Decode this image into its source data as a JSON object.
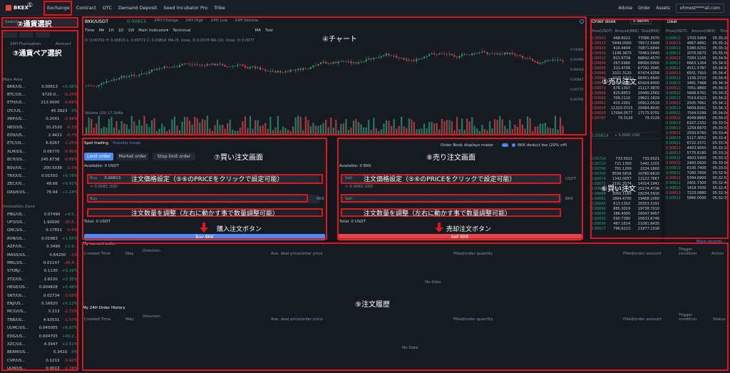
{
  "nav": {
    "logo": "BKEX",
    "items": [
      "Exchange",
      "Contract",
      "OTC",
      "Demand Deposit",
      "Seed Incubator Pro",
      "Tribe"
    ],
    "right": [
      "Advise",
      "Order",
      "Assets"
    ],
    "email": "ohmest****ail.com"
  },
  "market": {
    "search_placeholder": "Search",
    "columns": [
      "24H Fluctuation",
      "Amount"
    ],
    "main_area": "Main Area",
    "innovation_zone": "Innovation Zone",
    "pairs": [
      {
        "name": "BKK/US...",
        "price": "0.00813",
        "change": "+0.36%"
      },
      {
        "name": "BTC/US...",
        "price": "9720.0...",
        "change": "-0.23%"
      },
      {
        "name": "ETH/US...",
        "price": "213.0000",
        "change": "-0.86%"
      },
      {
        "name": "LTC/US...",
        "price": "45.3923",
        "change": "0%"
      },
      {
        "name": "XRP/US...",
        "price": "0.2041",
        "change": "-0.39%"
      },
      {
        "name": "NEO/US...",
        "price": "10.2520",
        "change": "-0.1%"
      },
      {
        "name": "EOS/US...",
        "price": "2.4421",
        "change": "-0.7%"
      },
      {
        "name": "ETC/US...",
        "price": "6.6267",
        "change": "-1.25%"
      },
      {
        "name": "XLM/US...",
        "price": "0.06770",
        "change": "-0.45%"
      },
      {
        "name": "BCH/US...",
        "price": "245.8738",
        "change": "-0.89%"
      },
      {
        "name": "BSV/US...",
        "price": "200.5038",
        "change": "-1.5%"
      },
      {
        "name": "TRX/US...",
        "price": "0.01550",
        "change": "+0.78%"
      },
      {
        "name": "ZEC/US...",
        "price": "48.66",
        "change": "+0.91%"
      },
      {
        "name": "DASH/US...",
        "price": "76.94",
        "change": "+1.24%"
      }
    ],
    "pairs2": [
      {
        "name": "PBG/US...",
        "price": "0.07490",
        "change": "+6.5..."
      },
      {
        "name": "UFO/US...",
        "price": "1.90000",
        "change": "-26.5..."
      },
      {
        "name": "QRC/US...",
        "price": "0.17651",
        "change": "-0.6%"
      },
      {
        "name": "RVN/US...",
        "price": "0.01983",
        "change": "+1.55%"
      },
      {
        "name": "AZP/US...",
        "price": "0.3490",
        "change": "+2.9..."
      },
      {
        "name": "MASS/US...",
        "price": "0.64200",
        "change": "-1%"
      },
      {
        "name": "MRL/US...",
        "price": "0.01147",
        "change": "-16.4..."
      },
      {
        "name": "STORJ/...",
        "price": "0.1130",
        "change": "+3.29%"
      },
      {
        "name": "XTZ/US...",
        "price": "2.8220",
        "change": "+2.35%"
      },
      {
        "name": "HEGE/US...",
        "price": "0.004828",
        "change": "+0.48%"
      },
      {
        "name": "SNT/US...",
        "price": "0.02734",
        "change": "-3.55%"
      },
      {
        "name": "ENJ/US...",
        "price": "0.16620",
        "change": "+5.12%"
      },
      {
        "name": "MCO/US...",
        "price": "5.513",
        "change": "-1.71%"
      },
      {
        "name": "TRB/US...",
        "price": "4.93531",
        "change": "-1.57%"
      },
      {
        "name": "ULMC/US...",
        "price": "0.045005",
        "change": "+6.87%"
      },
      {
        "name": "EDG/US...",
        "price": "0.004705",
        "change": "+40.2..."
      },
      {
        "name": "XZC/US...",
        "price": "4.3947",
        "change": "+2.51%"
      },
      {
        "name": "BEAM/US...",
        "price": "0.3410",
        "change": "0%"
      },
      {
        "name": "CVP/US...",
        "price": "0.1213",
        "change": "-3.42%"
      },
      {
        "name": "ULM/US...",
        "price": "0.0013",
        "change": "-1.18%"
      }
    ]
  },
  "chart": {
    "pair": "BKK/USDT",
    "price": "0.00813",
    "stats": [
      "24H Change",
      "24H High",
      "24H Low",
      "24H Volume"
    ],
    "intervals": [
      "Time",
      "M▾",
      "1H",
      "1D",
      "1W",
      "Main Indicator▾",
      "Technical",
      "MA",
      "Tool"
    ],
    "ohlc": "O: 0.00791  H: 0.00823  L: 0.00772  C: 0.00814",
    "ma": "MA (5, close, 0)  0.0078   MA (10, close, 0)  0.0077",
    "volume_label": "Volume (20)  17.1kMa",
    "y_ticks": [
      "0.01060",
      "0.00989",
      "0.00918",
      "0.00847",
      "0.00775",
      "0.00705"
    ],
    "accent": "#4a8cf7"
  },
  "trade": {
    "tabs": [
      "Spot trading",
      "Transfer funds"
    ],
    "order_types": [
      "Limit order",
      "Market order",
      "Stop-limit order"
    ],
    "available_buy": "Available: 0 USDT",
    "available_sell": "Available: 0 BKK",
    "buy_label": "Buy",
    "sell_label": "Sell",
    "price_value": "0.00813",
    "price_usd": "≈ 0.0081 USD",
    "quote": "USDT",
    "base": "BKK",
    "total": "Total:   0 USDT",
    "buy_button": "Buy BKK",
    "sell_button": "Sell BKK",
    "maker_toggle": "Order Book displays maker",
    "deduct": "BKK  deduct fee  (20% off)"
  },
  "orderbook": {
    "title": "Order Book",
    "depth": "5 decim",
    "columns": [
      "Price(USDT)",
      "Amount(BKK)",
      "Total(BKK)"
    ],
    "asks": [
      [
        "0.00930",
        "468.8022",
        "77086.3070"
      ],
      [
        "0.00923",
        "5444.0000",
        "76572.5048"
      ],
      [
        "0.00920",
        "414.4404",
        "70871.6844"
      ],
      [
        "0.00910",
        "1196.3670",
        "70463.0440"
      ],
      [
        "0.00910",
        "813.9734",
        "68842.4570"
      ],
      [
        "0.00899",
        "267.6966",
        "68060.0000"
      ],
      [
        "0.00895",
        "313.4706",
        "67792.3045"
      ],
      [
        "0.00890",
        "1021.3120",
        "67474.9258"
      ],
      [
        "0.00880",
        "1025.3210",
        "66451.6640"
      ],
      [
        "0.00875",
        "400.0000",
        "65424.8900"
      ],
      [
        "0.00872",
        "676.1307",
        "21117.3870"
      ],
      [
        "0.00869",
        "820.8653",
        "20440.3563"
      ],
      [
        "0.00865",
        "709.1110",
        "19621.1629"
      ],
      [
        "0.00862",
        "415.2001",
        "20912.0519"
      ],
      [
        "0.00826",
        "11320.0723",
        "20494.8630"
      ],
      [
        "0.00825",
        "17094.0577",
        "17175.9701"
      ],
      [
        "0.00797",
        "79.3129",
        "79.3129"
      ]
    ],
    "last_price": "0.00814",
    "last_usd": "≈ 0.0081 USD",
    "bids": [
      [
        "0.00724",
        "733.0021",
        "733.0021"
      ],
      [
        "0.00710",
        "721.1300",
        "1442.2201"
      ],
      [
        "0.00706",
        "761.1299",
        "2224.1600"
      ],
      [
        "0.00700",
        "8556.5818",
        "10780.6610"
      ],
      [
        "0.00674",
        "1342.0057",
        "12122.7667"
      ],
      [
        "0.00672",
        "2191.3574",
        "14314.1041"
      ],
      [
        "0.00670",
        "3142.3435",
        "15174.4736"
      ],
      [
        "0.00668",
        "3060.1180",
        "18234.5916"
      ],
      [
        "0.00662",
        "1864.4700",
        "19468.1000"
      ],
      [
        "0.00660",
        "613.1302",
        "20353.3191"
      ],
      [
        "0.00656",
        "885.3019",
        "19738.7010"
      ],
      [
        "0.00645",
        "386.4000",
        "20047.9457"
      ],
      [
        "0.00630",
        "590.7390",
        "20633.6746"
      ],
      [
        "0.00630",
        "467.1614",
        "21081.8435"
      ],
      [
        "0.00627",
        "796.6213",
        "21877.1018"
      ]
    ],
    "more": "More records"
  },
  "deal": {
    "title": "Deal",
    "columns": [
      "Price(USDT)",
      "Amount(BKK)",
      "Time"
    ],
    "rows": [
      [
        "0.00813",
        "1703.5964",
        "05:35:24"
      ],
      [
        "0.00813",
        "4867.4891",
        "05:35:14"
      ],
      [
        "0.00813",
        "5380.0251",
        "05:35:14"
      ],
      [
        "0.00813",
        "2076.5673",
        "05:35:04"
      ],
      [
        "0.00812",
        "7283.1155",
        "05:34:54"
      ],
      [
        "0.00813",
        "6663.1264",
        "05:34:53"
      ],
      [
        "0.00812",
        "4511.5787",
        "05:34:43"
      ],
      [
        "0.00813",
        "6501.7910",
        "05:34:47"
      ],
      [
        "0.00812",
        "1156.3723",
        "05:34:43"
      ],
      [
        "0.00813",
        "3481.7468",
        "05:34:34"
      ],
      [
        "0.00812",
        "7051.9800",
        "05:34:33"
      ],
      [
        "0.00813",
        "5668.6761",
        "05:34:33"
      ],
      [
        "0.00813",
        "7019.6323",
        "05:34:23"
      ],
      [
        "0.00813",
        "2505.7661",
        "05:34:13"
      ],
      [
        "0.00813",
        "5609.8261",
        "05:34:13"
      ],
      [
        "0.00812",
        "7564.5299",
        "05:34:04"
      ],
      [
        "0.00812",
        "4949.8665",
        "05:34:03"
      ],
      [
        "0.00813",
        "6107.2332",
        "05:33:54"
      ],
      [
        "0.00813",
        "1259.6670",
        "05:33:53"
      ],
      [
        "0.00813",
        "2593.6760",
        "05:33:44"
      ],
      [
        "0.00813",
        "5117.3052",
        "05:33:43"
      ],
      [
        "0.00812",
        "6722.1571",
        "05:33:34"
      ],
      [
        "0.00813",
        "4403.9550",
        "05:33:24"
      ],
      [
        "0.00813",
        "5770.6180",
        "05:33:24"
      ],
      [
        "0.00812",
        "4603.5900",
        "05:33:13"
      ],
      [
        "0.00812",
        "2483.0920",
        "05:33:04"
      ],
      [
        "0.00813",
        "6330.7400",
        "05:33:03"
      ],
      [
        "0.00812",
        "7260.7600",
        "05:32:54"
      ],
      [
        "0.00812",
        "5394.0900",
        "05:32:53"
      ],
      [
        "0.00812",
        "2401.7300",
        "05:32:44"
      ],
      [
        "0.00812",
        "1419.7000",
        "05:32:43"
      ],
      [
        "0.00813",
        "7223.0880",
        "05:32:34"
      ],
      [
        "0.00812",
        "5860.0000",
        "05:32:33"
      ]
    ]
  },
  "orders": {
    "current_title": "My current order",
    "current_cols": [
      "Created Time",
      "Way",
      "Direction",
      "Ave. deal price/order price",
      "Filled/order quantity",
      "Filled/order amount",
      "Trigger condition",
      "Action"
    ],
    "history_title": "My 24H Order History",
    "history_cols": [
      "Created Time",
      "Way",
      "Direction",
      "Ave. deal price/order price",
      "Filled/order quantity",
      "Filled/order amount",
      "Trigger condition",
      "Status"
    ],
    "no_data": "No Data"
  },
  "annotations": {
    "n1": "①",
    "n2": "②通貨選択",
    "n3": "③通貨ペア選択",
    "n4": "④チャート",
    "n5": "⑤売り注文",
    "n6": "⑥買い注文",
    "n7": "⑦買い注文画面",
    "n8": "⑧売り注文画面",
    "n9": "⑨注文履歴",
    "price_setting": "注文価格設定（⑤⑥のPRICEをクリックで設定可能）",
    "qty_setting": "注文数量を調整（左右に動かす事で数量調整可能）",
    "buy_btn_note": "購入注文ボタン",
    "sell_btn_note": "売却注文ボタン"
  },
  "colors": {
    "up": "#2ea37a",
    "down": "#e0484c",
    "accent": "#4a8cf7",
    "annotation": "#e0161c"
  }
}
